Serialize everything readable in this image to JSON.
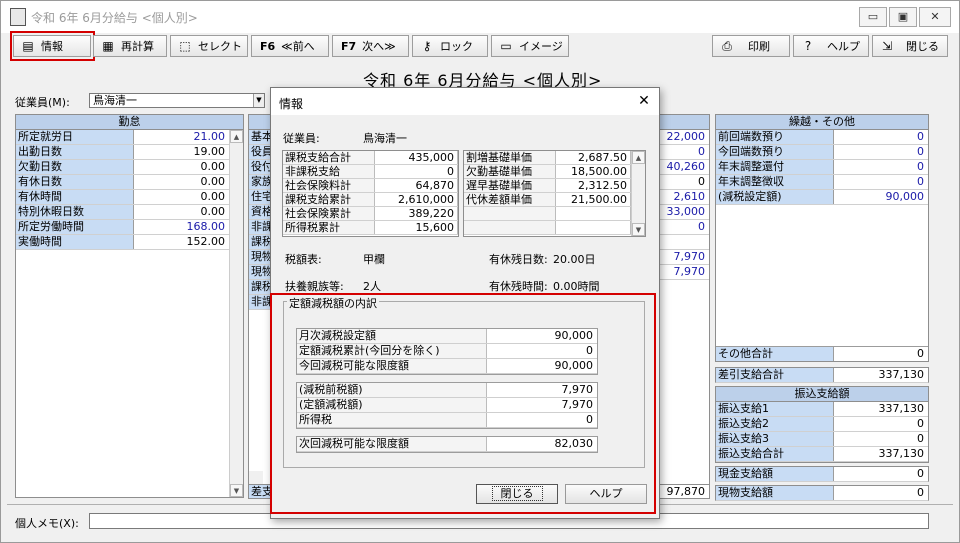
{
  "window": {
    "title": "令和 6年 6月分給与 <個人別>",
    "min": "▭",
    "max": "▣",
    "close": "✕"
  },
  "toolbar": {
    "info": "情報",
    "recalc": "再計算",
    "select": "セレクト",
    "f6": "F6",
    "prev": "≪前へ",
    "f7": "F7",
    "next": "次へ≫",
    "lock": "ロック",
    "image": "イメージ",
    "print": "印刷",
    "help": "ヘルプ",
    "close": "閉じる"
  },
  "heading": "令和 6年 6月分給与 <個人別>",
  "employee": {
    "label": "従業員(M):",
    "value": "鳥海清一"
  },
  "attendance": {
    "header": "勤怠",
    "rows": [
      {
        "k": "所定就労日",
        "v": "21.00",
        "blue": true
      },
      {
        "k": "出勤日数",
        "v": "19.00",
        "blue": false
      },
      {
        "k": "欠勤日数",
        "v": "0.00",
        "blue": false
      },
      {
        "k": "有休日数",
        "v": "0.00",
        "blue": false
      },
      {
        "k": "有休時間",
        "v": "0.00",
        "blue": false
      },
      {
        "k": "特別休暇日数",
        "v": "0.00",
        "blue": false
      },
      {
        "k": "所定労働時間",
        "v": "168.00",
        "blue": true
      },
      {
        "k": "実働時間",
        "v": "152.00",
        "blue": false
      }
    ]
  },
  "middle": {
    "labels": [
      "基本",
      "役員",
      "役付",
      "家族",
      "住宅",
      "資格",
      "非課",
      "課税",
      "現物",
      "現物",
      "課税",
      "非課"
    ],
    "values": [
      {
        "v": "22,000",
        "blue": true
      },
      {
        "v": "0",
        "blue": true
      },
      {
        "v": "40,260",
        "blue": true
      },
      {
        "v": "0",
        "blue": false
      },
      {
        "v": "2,610",
        "blue": true
      },
      {
        "v": "33,000",
        "blue": true
      },
      {
        "v": "0",
        "blue": true
      },
      {
        "v": "",
        "blue": false
      },
      {
        "v": "7,970",
        "blue": true
      },
      {
        "v": "7,970",
        "blue": true
      }
    ],
    "total_label": "差支",
    "total_value": "97,870"
  },
  "carry": {
    "header": "繰越・その他",
    "rows": [
      {
        "k": "前回端数預り",
        "v": "0"
      },
      {
        "k": "今回端数預り",
        "v": "0"
      },
      {
        "k": "年末調整還付",
        "v": "0"
      },
      {
        "k": "年末調整徴収",
        "v": "0"
      },
      {
        "k": "(減税設定額)",
        "v": "90,000"
      }
    ],
    "other_total": {
      "k": "その他合計",
      "v": "0"
    },
    "net": {
      "k": "差引支給合計",
      "v": "337,130"
    }
  },
  "transfer": {
    "header": "振込支給額",
    "rows": [
      {
        "k": "振込支給1",
        "v": "337,130"
      },
      {
        "k": "振込支給2",
        "v": "0"
      },
      {
        "k": "振込支給3",
        "v": "0"
      },
      {
        "k": "振込支給合計",
        "v": "337,130"
      }
    ]
  },
  "cash": {
    "k": "現金支給額",
    "v": "0"
  },
  "goods": {
    "k": "現物支給額",
    "v": "0"
  },
  "memo": {
    "label": "個人メモ(X):",
    "value": ""
  },
  "dialog": {
    "title": "情報",
    "close": "✕",
    "employee_label": "従業員:",
    "employee_value": "鳥海清一",
    "left_rows": [
      {
        "k": "課税支給合計",
        "v": "435,000"
      },
      {
        "k": "非課税支給",
        "v": "0"
      },
      {
        "k": "社会保険料計",
        "v": "64,870"
      },
      {
        "k": "課税支給累計",
        "v": "2,610,000"
      },
      {
        "k": "社会保険累計",
        "v": "389,220"
      },
      {
        "k": "所得税累計",
        "v": "15,600"
      }
    ],
    "right_rows": [
      {
        "k": "割増基礎単価",
        "v": "2,687.50"
      },
      {
        "k": "欠勤基礎単価",
        "v": "18,500.00"
      },
      {
        "k": "遅早基礎単価",
        "v": "2,312.50"
      },
      {
        "k": "代休差額単価",
        "v": "21,500.00"
      },
      {
        "k": "",
        "v": ""
      },
      {
        "k": "",
        "v": ""
      }
    ],
    "tax_table_label": "税額表:",
    "tax_table_value": "甲欄",
    "paid_leave_days_label": "有休残日数:",
    "paid_leave_days_value": "20.00日",
    "dependents_label": "扶養親族等:",
    "dependents_value": "2人",
    "paid_leave_hours_label": "有休残時間:",
    "paid_leave_hours_value": "0.00時間",
    "group_label": "定額減税額の内訳",
    "group1": [
      {
        "k": "月次減税設定額",
        "v": "90,000"
      },
      {
        "k": "定額減税累計(今回分を除く)",
        "v": "0"
      },
      {
        "k": "今回減税可能な限度額",
        "v": "90,000"
      }
    ],
    "group2": [
      {
        "k": "(減税前税額)",
        "v": "7,970"
      },
      {
        "k": "(定額減税額)",
        "v": "7,970"
      },
      {
        "k": "所得税",
        "v": "0"
      }
    ],
    "group3": [
      {
        "k": "次回減税可能な限度額",
        "v": "82,030"
      }
    ],
    "close_button": "閉じる",
    "help_button": "ヘルプ"
  },
  "colors": {
    "highlight": "#d40000",
    "label_bg": "#c8dcf4",
    "header_bg": "#bcd0ea",
    "blue_value": "#1a1aa8"
  }
}
